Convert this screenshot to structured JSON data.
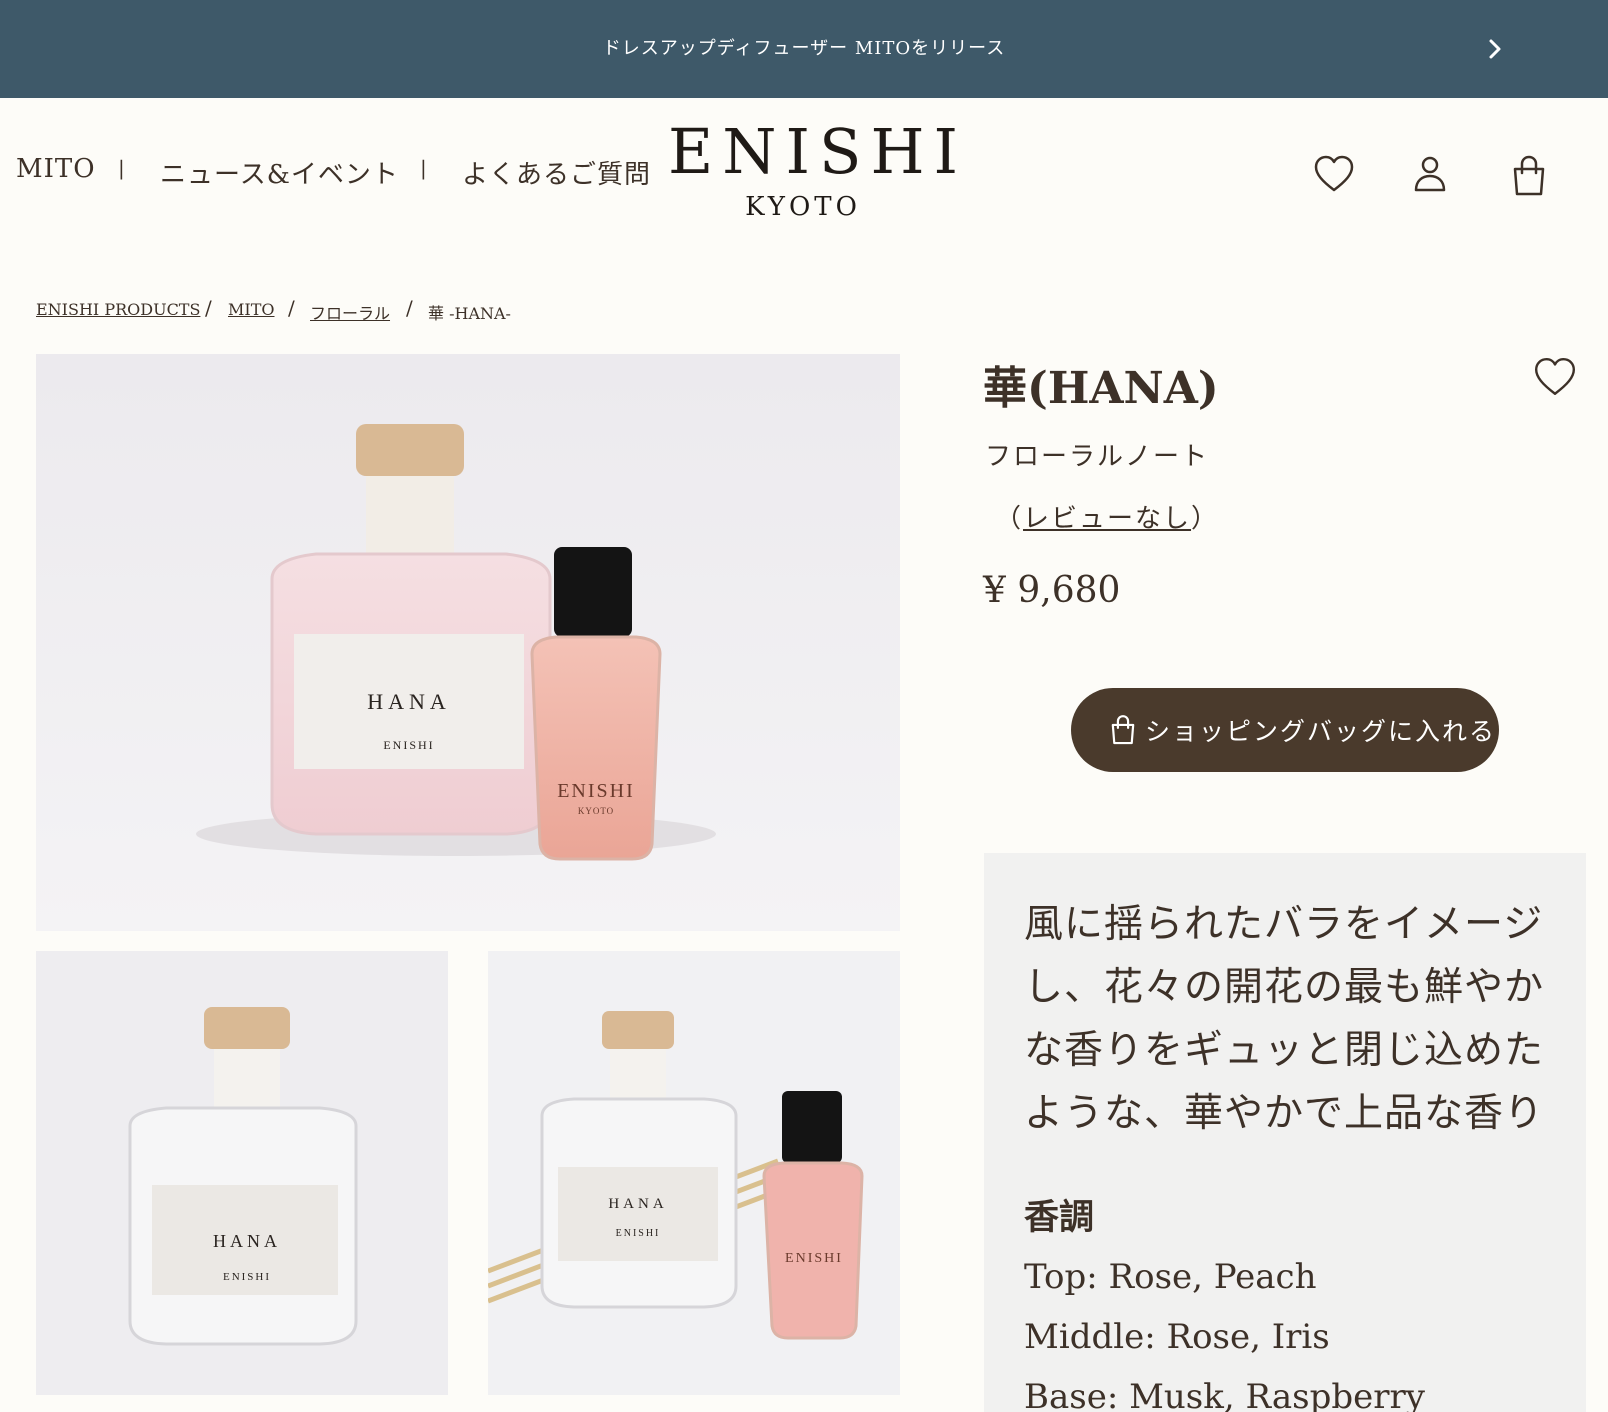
{
  "announcement": {
    "text": "ドレスアップディフューザー MITOをリリース"
  },
  "nav": {
    "items": [
      "MITO",
      "ニュース&イベント",
      "よくあるご質問"
    ],
    "separator": "|"
  },
  "logo": {
    "main": "ENISHI",
    "sub": "KYOTO"
  },
  "header_icons": [
    "heart-icon",
    "user-icon",
    "bag-icon"
  ],
  "breadcrumb": {
    "items": [
      "ENISHI PRODUCTS",
      "MITO",
      "フローラル"
    ],
    "current": "華 -HANA-",
    "separator": "/"
  },
  "product": {
    "title": "華(HANA)",
    "note": "フローラルノート",
    "review_prefix": "（",
    "review_link": "レビューなし",
    "review_suffix": "）",
    "price": "¥ 9,680",
    "cart_button": "ショッピングバッグに入れる",
    "description_lines": [
      "風に揺られたバラをイメージ",
      "し、花々の開花の最も鮮やか",
      "な香りをギュッと閉じ込めた",
      "ような、華やかで上品な香り"
    ],
    "scent_title": "香調",
    "scent_notes": [
      "Top: Rose, Peach",
      "Middle: Rose, Iris",
      "Base: Musk, Raspberry"
    ]
  },
  "images": {
    "label_name": "HANA",
    "label_brand": "ENISHI",
    "label_sub": "KYOTO"
  },
  "colors": {
    "announcement_bg": "#3e5969",
    "button_bg": "#4a3a2c",
    "text": "#3d3128",
    "page_bg": "#fdfcf8",
    "desc_bg": "#f1f1f0"
  }
}
